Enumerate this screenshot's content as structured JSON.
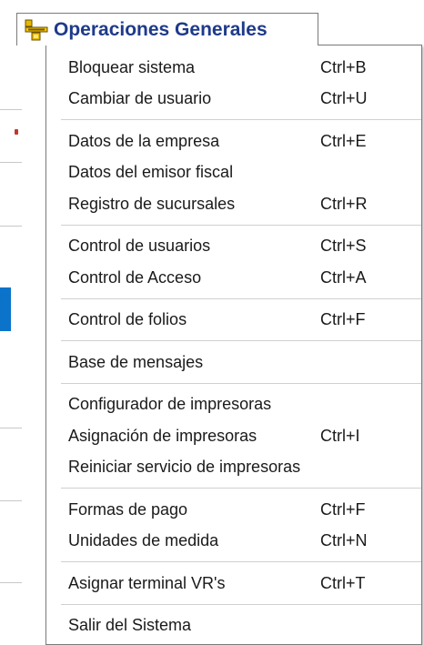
{
  "menu": {
    "title": "Operaciones Generales",
    "icon": "app-menu-icon",
    "groups": [
      [
        {
          "label": "Bloquear sistema",
          "shortcut": "Ctrl+B"
        },
        {
          "label": "Cambiar de usuario",
          "shortcut": "Ctrl+U"
        }
      ],
      [
        {
          "label": "Datos de la empresa",
          "shortcut": "Ctrl+E"
        },
        {
          "label": "Datos del emisor fiscal",
          "shortcut": ""
        },
        {
          "label": "Registro de sucursales",
          "shortcut": "Ctrl+R"
        }
      ],
      [
        {
          "label": "Control de usuarios",
          "shortcut": "Ctrl+S"
        },
        {
          "label": "Control de Acceso",
          "shortcut": "Ctrl+A"
        }
      ],
      [
        {
          "label": "Control de folios",
          "shortcut": "Ctrl+F"
        }
      ],
      [
        {
          "label": "Base de mensajes",
          "shortcut": ""
        }
      ],
      [
        {
          "label": "Configurador de impresoras",
          "shortcut": ""
        },
        {
          "label": "Asignación de impresoras",
          "shortcut": "Ctrl+I"
        },
        {
          "label": "Reiniciar servicio de impresoras",
          "shortcut": ""
        }
      ],
      [
        {
          "label": "Formas de pago",
          "shortcut": "Ctrl+F"
        },
        {
          "label": "Unidades de medida",
          "shortcut": "Ctrl+N"
        }
      ],
      [
        {
          "label": "Asignar terminal VR's",
          "shortcut": "Ctrl+T"
        }
      ],
      [
        {
          "label": "Salir del Sistema",
          "shortcut": ""
        }
      ]
    ]
  },
  "colors": {
    "title_text": "#1e3a8a",
    "background_accent": "#0b73c9"
  }
}
